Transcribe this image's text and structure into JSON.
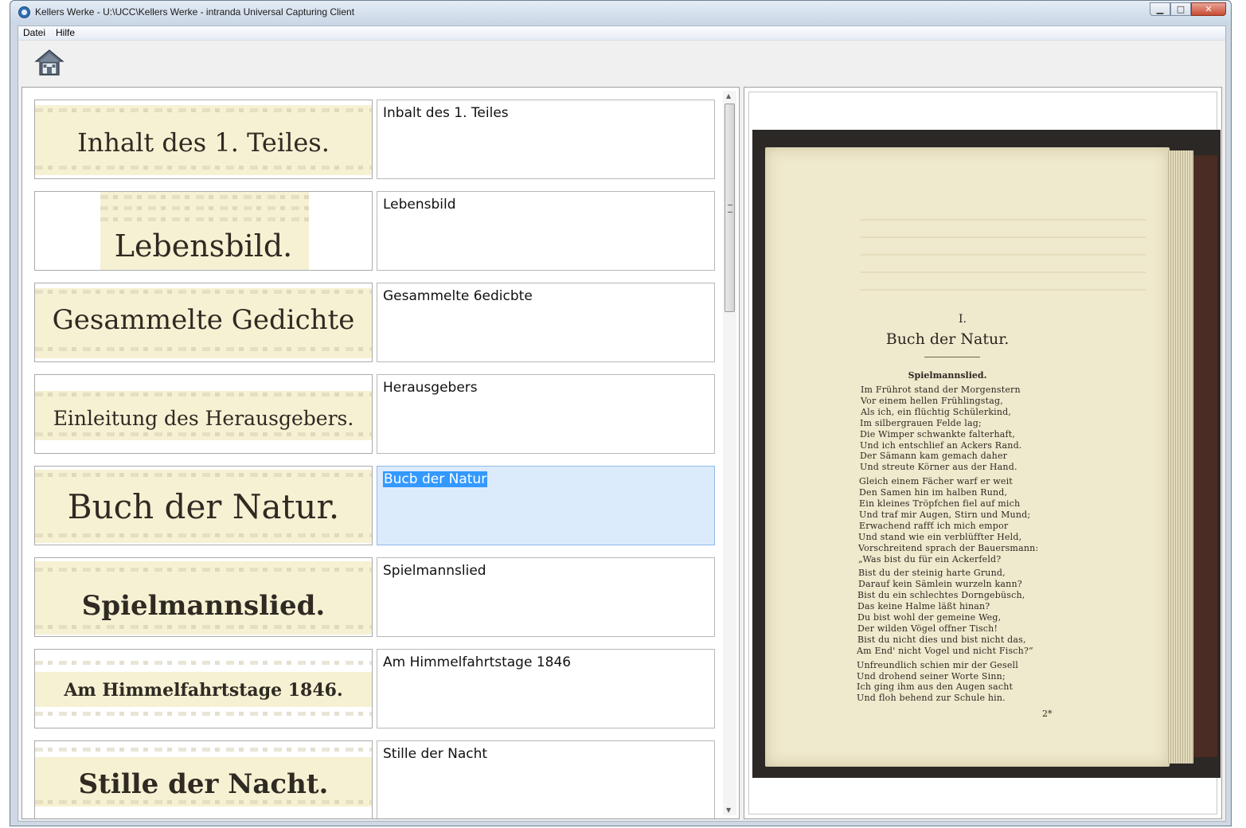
{
  "window": {
    "title": "Kellers Werke - U:\\UCC\\Kellers Werke - intranda Universal Capturing Client",
    "buttons": {
      "minimize": "▁",
      "maximize": "□",
      "close": "✕"
    }
  },
  "menu": {
    "items": [
      "Datei",
      "Hilfe"
    ]
  },
  "toolbar": {
    "home_icon": "home-icon"
  },
  "entries": [
    {
      "thumb_text": "Inhalt des 1. Teiles.",
      "value": "Inbalt des 1. Teiles"
    },
    {
      "thumb_text": "Lebensbild.",
      "value": "Lebensbild"
    },
    {
      "thumb_text": "Gesammelte Gedichte",
      "value": "Gesammelte 6edicbte"
    },
    {
      "thumb_text": "Einleitung des Herausgebers.",
      "value": "Herausgebers"
    },
    {
      "thumb_text": "Buch der Natur.",
      "value": "Bucb der Natur",
      "selected": true
    },
    {
      "thumb_text": "Spielmannslied.",
      "value": "Spielmannslied"
    },
    {
      "thumb_text": "Am Himmelfahrtstage 1846.",
      "value": "Am Himmelfahrtstage 1846"
    },
    {
      "thumb_text": "Stille der Nacht.",
      "value": "Stille der Nacht"
    }
  ],
  "preview": {
    "number": "I.",
    "heading": "Buch der Natur.",
    "subheading": "Spielmannslied.",
    "lines": [
      "Im Frührot stand der Morgenstern",
      "Vor einem hellen Frühlingstag,",
      "Als ich, ein flüchtig Schülerkind,",
      "Im silbergrauen Felde lag;",
      "Die Wimper schwankte falterhaft,",
      "Und ich entschlief an Ackers Rand.",
      "Der Sämann kam gemach daher",
      "Und streute Körner aus der Hand.",
      "Gleich einem Fächer warf er weit",
      "Den Samen hin im halben Rund,",
      "Ein kleines Tröpfchen fiel auf mich",
      "Und traf mir Augen, Stirn und Mund;",
      "Erwachend raffť ich mich empor",
      "Und stand wie ein verblüffter Held,",
      "Vorschreitend sprach der Bauersmann:",
      "„Was bist du für ein Ackerfeld?",
      "Bist du der steinig harte Grund,",
      "Darauf kein Sämlein wurzeln kann?",
      "Bist du ein schlechtes Dorngebüsch,",
      "Das keine Halme läßt hinan?",
      "Du bist wohl der gemeine Weg,",
      "Der wilden Vögel offner Tisch!",
      "Bist du nicht dies und bist nicht das,",
      "Am End' nicht Vogel und nicht Fisch?“",
      "Unfreundlich schien mir der Gesell",
      "Und drohend seiner Worte Sinn;",
      "Ich ging ihm aus den Augen sacht",
      "Und floh behend zur Schule hin."
    ],
    "signature": "2*"
  }
}
